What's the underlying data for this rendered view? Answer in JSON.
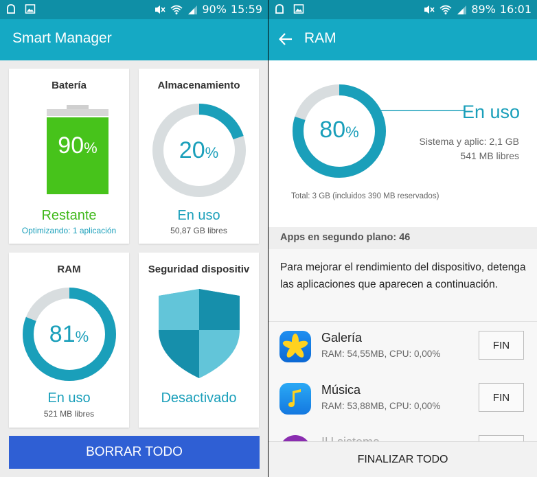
{
  "colors": {
    "accent": "#15a9c4",
    "statusbar": "#0f8fa6",
    "battery_green": "#47c31b",
    "gauge_gray": "#d8dddf",
    "clear_button": "#2f5fd4"
  },
  "left": {
    "status": {
      "battery": "90%",
      "time": "15:59"
    },
    "title": "Smart Manager",
    "battery": {
      "title": "Batería",
      "value": "90",
      "unit": "%",
      "level": 0.9,
      "status": "Restante",
      "sub": "Optimizando: 1 aplicación"
    },
    "storage": {
      "title": "Almacenamiento",
      "value": "20",
      "unit": "%",
      "fraction": 0.2,
      "status": "En uso",
      "sub": "50,87 GB libres"
    },
    "ram": {
      "title": "RAM",
      "value": "81",
      "unit": "%",
      "fraction": 0.81,
      "status": "En uso",
      "sub": "521 MB libres"
    },
    "security": {
      "title": "Seguridad dispositiv",
      "status": "Desactivado"
    },
    "clear_button": "BORRAR TODO"
  },
  "right": {
    "status": {
      "battery": "89%",
      "time": "16:01"
    },
    "title": "RAM",
    "gauge": {
      "value": "80",
      "unit": "%",
      "fraction": 0.8
    },
    "in_use_label": "En uso",
    "system_apps": "Sistema y aplic: 2,1 GB",
    "free": "541 MB libres",
    "total": "Total: 3 GB (incluidos 390 MB reservados)",
    "bg_apps": "Apps en segundo plano: 46",
    "description": "Para mejorar el rendimiento del dispositivo, detenga las aplicaciones que aparecen a continuación.",
    "apps": [
      {
        "name": "Galería",
        "info": "RAM: 54,55MB, CPU: 0,00%",
        "button": "FIN",
        "icon": "gallery-icon"
      },
      {
        "name": "Música",
        "info": "RAM: 53,88MB, CPU: 0,00%",
        "button": "FIN",
        "icon": "music-icon"
      },
      {
        "name": "IU sistema",
        "info": "",
        "button": "FIN",
        "icon": "system-ui-icon"
      }
    ],
    "finalize": "FINALIZAR TODO"
  }
}
